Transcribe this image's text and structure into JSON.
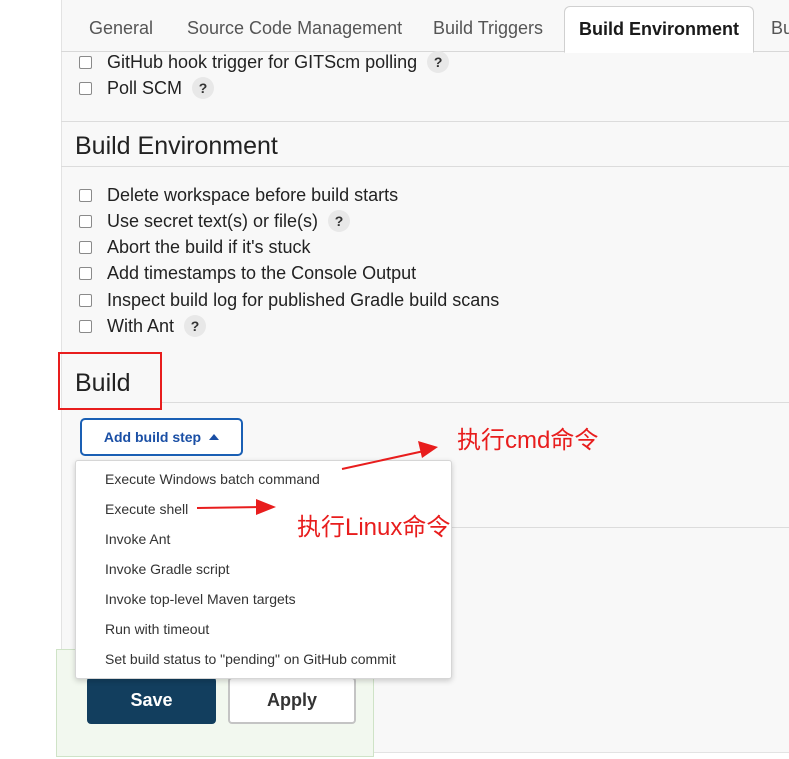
{
  "tabs": [
    "General",
    "Source Code Management",
    "Build Triggers",
    "Build Environment",
    "Bu"
  ],
  "active_tab": "Build Environment",
  "triggers": [
    {
      "label": "GitHub hook trigger for GITScm polling",
      "help": true
    },
    {
      "label": "Poll SCM",
      "help": true
    }
  ],
  "build_environment": {
    "title": "Build Environment",
    "options": [
      {
        "label": "Delete workspace before build starts",
        "help": false
      },
      {
        "label": "Use secret text(s) or file(s)",
        "help": true
      },
      {
        "label": "Abort the build if it's stuck",
        "help": false
      },
      {
        "label": "Add timestamps to the Console Output",
        "help": false
      },
      {
        "label": "Inspect build log for published Gradle build scans",
        "help": false
      },
      {
        "label": "With Ant",
        "help": true
      }
    ]
  },
  "help_symbol": "?",
  "build": {
    "title": "Build",
    "add_step_label": "Add build step",
    "menu_items": [
      "Execute Windows batch command",
      "Execute shell",
      "Invoke Ant",
      "Invoke Gradle script",
      "Invoke top-level Maven targets",
      "Run with timeout",
      "Set build status to \"pending\" on GitHub commit"
    ]
  },
  "buttons": {
    "save": "Save",
    "apply": "Apply"
  },
  "annotations": {
    "cmd": "执行cmd命令",
    "linux": "执行Linux命令"
  },
  "colors": {
    "annotation": "#e81d1d",
    "save_bg": "#123e5e",
    "accent": "#1a5fb4"
  }
}
